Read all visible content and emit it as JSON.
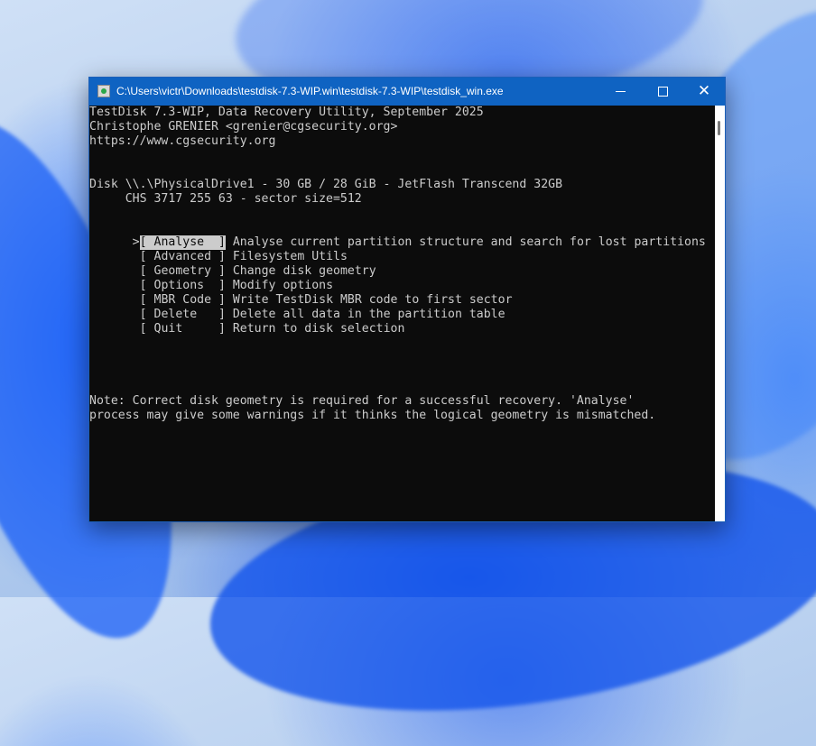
{
  "window": {
    "title": "C:\\Users\\victr\\Downloads\\testdisk-7.3-WIP.win\\testdisk-7.3-WIP\\testdisk_win.exe",
    "minimize_glyph": "",
    "maximize_glyph": "",
    "close_glyph": "✕",
    "titlebar_color": "#0f63c2"
  },
  "console": {
    "header": [
      "TestDisk 7.3-WIP, Data Recovery Utility, September 2025",
      "Christophe GRENIER <grenier@cgsecurity.org>",
      "https://www.cgsecurity.org"
    ],
    "disk_line1": "Disk \\\\.\\PhysicalDrive1 - 30 GB / 28 GiB - JetFlash Transcend 32GB",
    "disk_line2": "     CHS 3717 255 63 - sector size=512",
    "cursor": ">",
    "menu": [
      {
        "button": "[ Analyse  ]",
        "desc": " Analyse current partition structure and search for lost partitions",
        "selected": true
      },
      {
        "button": "[ Advanced ]",
        "desc": " Filesystem Utils",
        "selected": false
      },
      {
        "button": "[ Geometry ]",
        "desc": " Change disk geometry",
        "selected": false
      },
      {
        "button": "[ Options  ]",
        "desc": " Modify options",
        "selected": false
      },
      {
        "button": "[ MBR Code ]",
        "desc": " Write TestDisk MBR code to first sector",
        "selected": false
      },
      {
        "button": "[ Delete   ]",
        "desc": " Delete all data in the partition table",
        "selected": false
      },
      {
        "button": "[ Quit     ]",
        "desc": " Return to disk selection",
        "selected": false
      }
    ],
    "note_line1": "Note: Correct disk geometry is required for a successful recovery. 'Analyse'",
    "note_line2": "process may give some warnings if it thinks the logical geometry is mismatched.",
    "text_color": "#cccccc",
    "background": "#0c0c0c"
  }
}
